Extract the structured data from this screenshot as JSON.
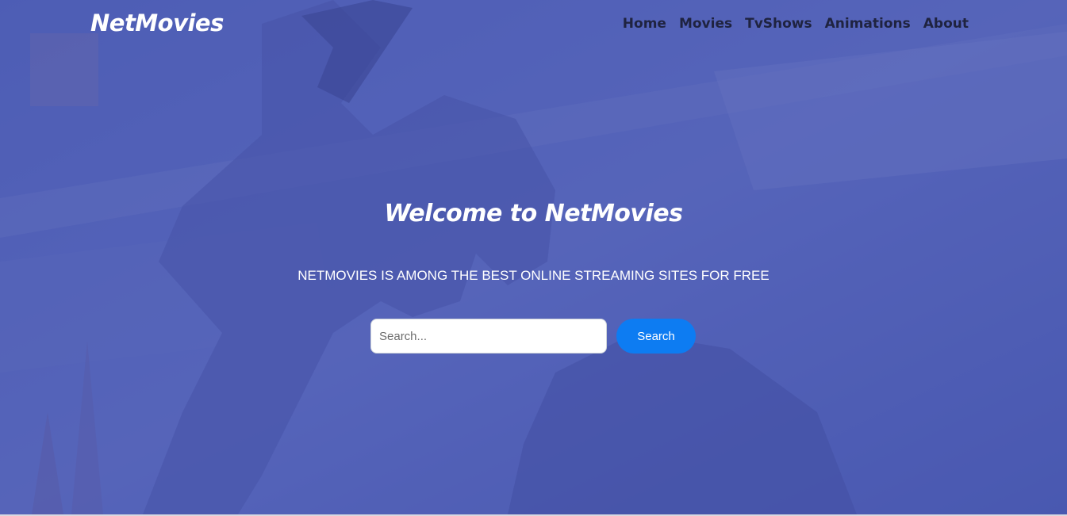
{
  "brand": {
    "name": "NetMovies"
  },
  "nav": {
    "items": [
      {
        "label": "Home"
      },
      {
        "label": "Movies"
      },
      {
        "label": "TvShows"
      },
      {
        "label": "Animations"
      },
      {
        "label": "About"
      }
    ]
  },
  "hero": {
    "title": "Welcome to NetMovies",
    "tagline": "NETMOVIES IS AMONG THE BEST ONLINE STREAMING SITES FOR FREE"
  },
  "search": {
    "placeholder": "Search...",
    "value": "",
    "button_label": "Search"
  },
  "colors": {
    "overlay": "#4656b2",
    "button": "#0d7cf2",
    "nav_text": "#1f2340",
    "heading_text": "#ffffff"
  }
}
